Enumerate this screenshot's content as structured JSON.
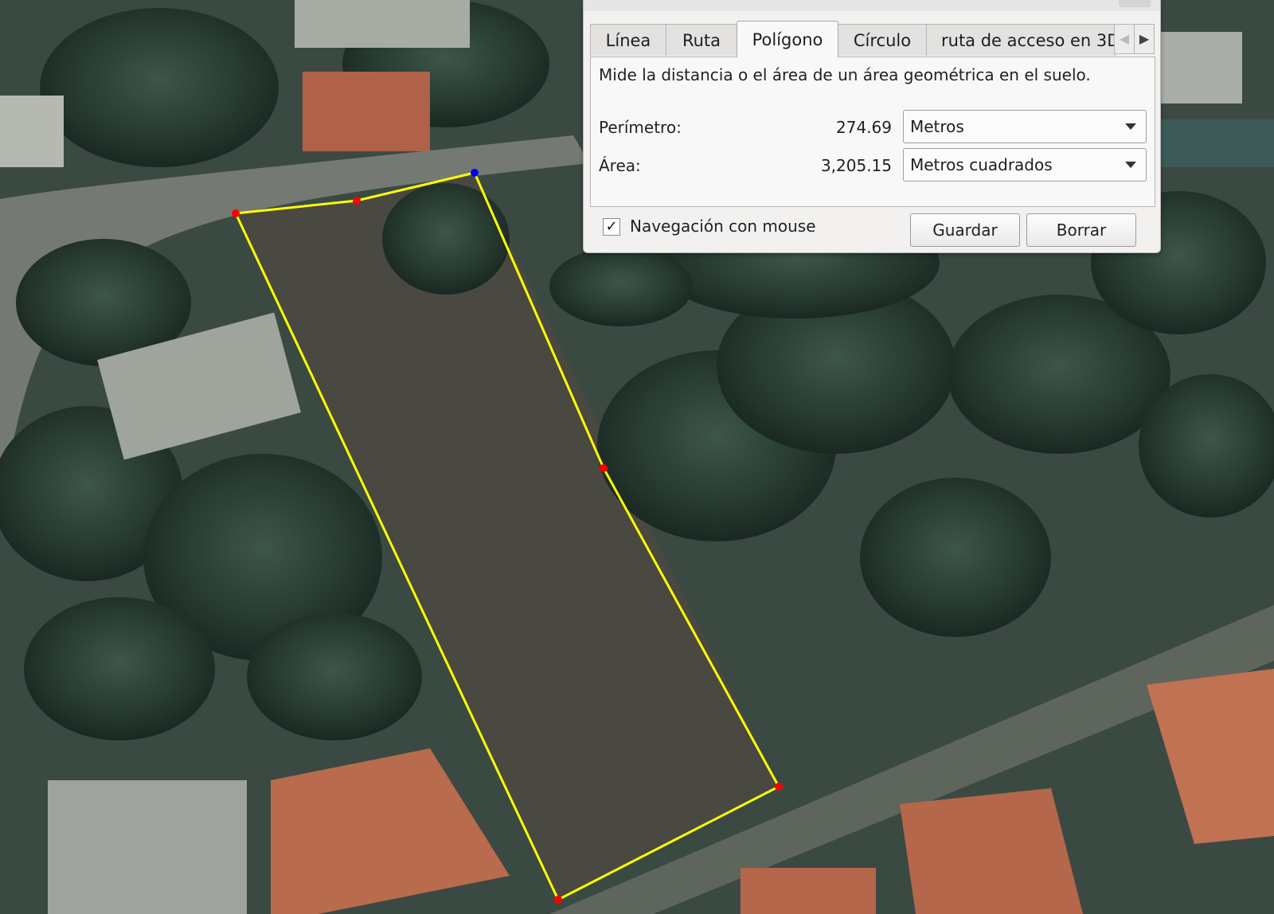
{
  "tool_dialog": {
    "tabs": [
      {
        "label": "Línea"
      },
      {
        "label": "Ruta"
      },
      {
        "label": "Polígono"
      },
      {
        "label": "Círculo"
      },
      {
        "label": "ruta de acceso en 3D"
      }
    ],
    "active_tab": "Polígono",
    "description": "Mide la distancia o el área de un área geométrica en el suelo.",
    "perimeter": {
      "label": "Perímetro:",
      "value": "274.69",
      "unit": "Metros"
    },
    "area": {
      "label": "Área:",
      "value": "3,205.15",
      "unit": "Metros cuadrados"
    },
    "mouse_navigation": {
      "label": "Navegación con mouse",
      "checked": true,
      "check_glyph": "✓"
    },
    "buttons": {
      "save": "Guardar",
      "clear": "Borrar"
    }
  },
  "map": {
    "polygon_color": "#ffff00",
    "vertex_color": "#ff0000",
    "active_vertex_color": "#0000ff"
  }
}
